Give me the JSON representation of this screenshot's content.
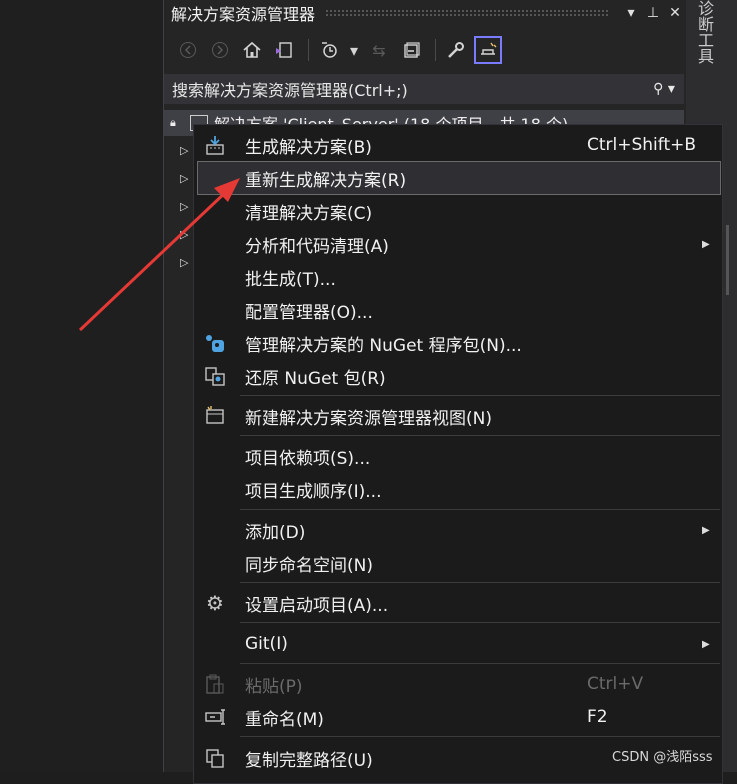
{
  "panel": {
    "title": "解决方案资源管理器",
    "title_icons": [
      "dropdown-icon",
      "pin-icon",
      "close-icon"
    ],
    "right_tab": "诊断工具",
    "search_placeholder": "搜索解决方案资源管理器(Ctrl+;)",
    "tree_header": "解决方案 'Client_Server' (18 个项目，共 18 个)"
  },
  "menu": {
    "items": [
      {
        "label": "生成解决方案(B)",
        "shortcut": "Ctrl+Shift+B",
        "icon": "build-icon"
      },
      {
        "label": "重新生成解决方案(R)",
        "highlighted": true
      },
      {
        "label": "清理解决方案(C)"
      },
      {
        "label": "分析和代码清理(A)",
        "submenu": true
      },
      {
        "label": "批生成(T)..."
      },
      {
        "label": "配置管理器(O)..."
      },
      {
        "label": "管理解决方案的 NuGet 程序包(N)...",
        "icon": "nuget-icon"
      },
      {
        "label": "还原 NuGet 包(R)",
        "icon": "restore-icon"
      },
      {
        "label": "新建解决方案资源管理器视图(N)",
        "icon": "new-view-icon"
      },
      {
        "label": "项目依赖项(S)..."
      },
      {
        "label": "项目生成顺序(I)..."
      },
      {
        "label": "添加(D)",
        "submenu": true
      },
      {
        "label": "同步命名空间(N)"
      },
      {
        "label": "设置启动项目(A)...",
        "icon": "gear-icon"
      },
      {
        "label": "Git(I)",
        "submenu": true
      },
      {
        "label": "粘贴(P)",
        "shortcut": "Ctrl+V",
        "disabled": true,
        "icon": "paste-icon"
      },
      {
        "label": "重命名(M)",
        "shortcut": "F2",
        "icon": "rename-icon"
      },
      {
        "label": "复制完整路径(U)",
        "icon": "copy-path-icon"
      }
    ]
  },
  "watermark": "CSDN @浅陌sss",
  "colors": {
    "highlight_border": "#7b7bff",
    "annotation_arrow": "#e53935"
  }
}
